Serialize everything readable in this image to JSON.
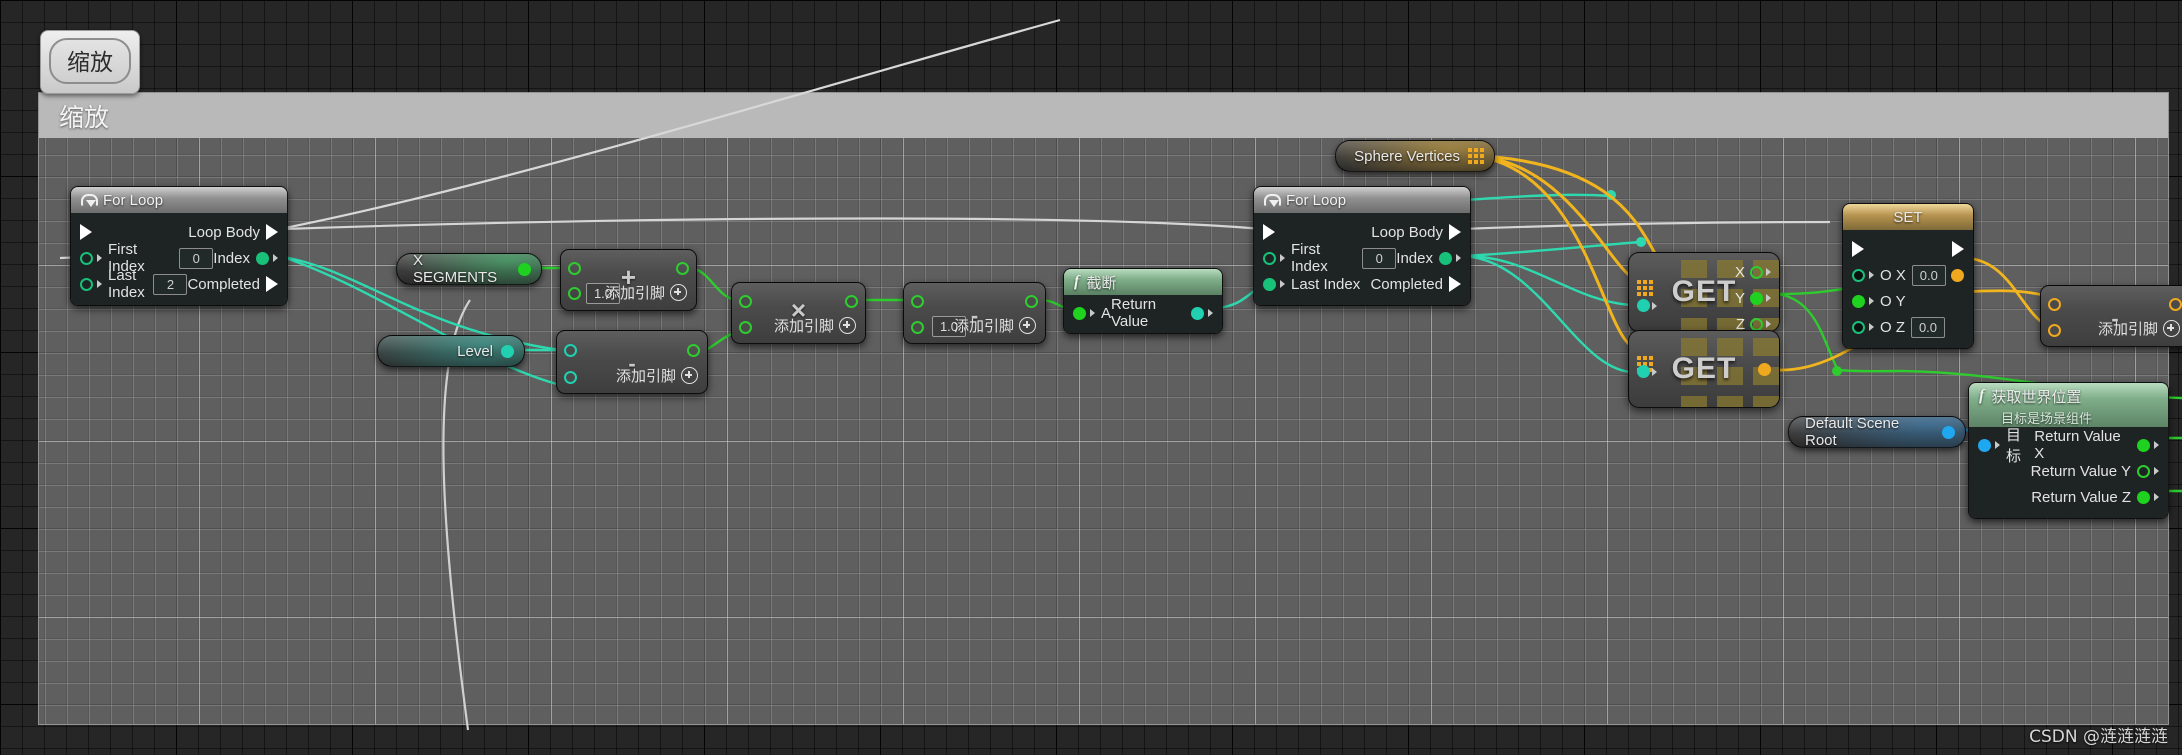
{
  "editor": {
    "comment_chip_label": "缩放",
    "comment_title": "缩放",
    "watermark": "CSDN @涟涟涟涟"
  },
  "nodes": {
    "for_loop_1": {
      "title": "For Loop",
      "loop_body": "Loop Body",
      "first_index_label": "First Index",
      "first_index_value": "0",
      "last_index_label": "Last Index",
      "last_index_value": "2",
      "index_label": "Index",
      "completed_label": "Completed"
    },
    "for_loop_2": {
      "title": "For Loop",
      "loop_body": "Loop Body",
      "first_index_label": "First Index",
      "first_index_value": "0",
      "last_index_label": "Last Index",
      "index_label": "Index",
      "completed_label": "Completed"
    },
    "x_segments": {
      "label": "X SEGMENTS"
    },
    "level": {
      "label": "Level"
    },
    "sphere_vertices": {
      "label": "Sphere Vertices",
      "icon": "array-grid-icon"
    },
    "default_scene_root": {
      "label": "Default Scene Root"
    },
    "add_node": {
      "op": "+",
      "add_pin_label": "添加引脚",
      "inline_value": "1.0"
    },
    "sub_node_level": {
      "op": "-",
      "add_pin_label": "添加引脚"
    },
    "mul_node": {
      "op": "×",
      "add_pin_label": "添加引脚"
    },
    "sub_node_b": {
      "op": "-",
      "add_pin_label": "添加引脚",
      "inline_value": "1.0"
    },
    "truncate": {
      "title": "截断",
      "input_a": "A",
      "return_value": "Return Value"
    },
    "get_vector": {
      "label": "GET",
      "x": "X",
      "y": "Y",
      "z": "Z"
    },
    "get_struct": {
      "label": "GET"
    },
    "set_node": {
      "title": "SET",
      "x_label": "O X",
      "x_value": "0.0",
      "y_label": "O Y",
      "z_label": "O Z",
      "z_value": "0.0"
    },
    "get_world_location": {
      "title": "获取世界位置",
      "subtitle": "目标是场景组件",
      "target_label": "目标",
      "return_x": "Return Value X",
      "return_y": "Return Value Y",
      "return_z": "Return Value Z"
    },
    "sub_node_vec": {
      "op": "-",
      "add_pin_label": "添加引脚"
    }
  },
  "colors": {
    "exec_white": "#ffffff",
    "int_green": "#19c07a",
    "float_green": "#2ecc2e",
    "vector_orange": "#f0a81e",
    "object_blue": "#1fa7f0",
    "cyan_wire": "#20d0b0",
    "comment_header": "#b9b9b9"
  }
}
